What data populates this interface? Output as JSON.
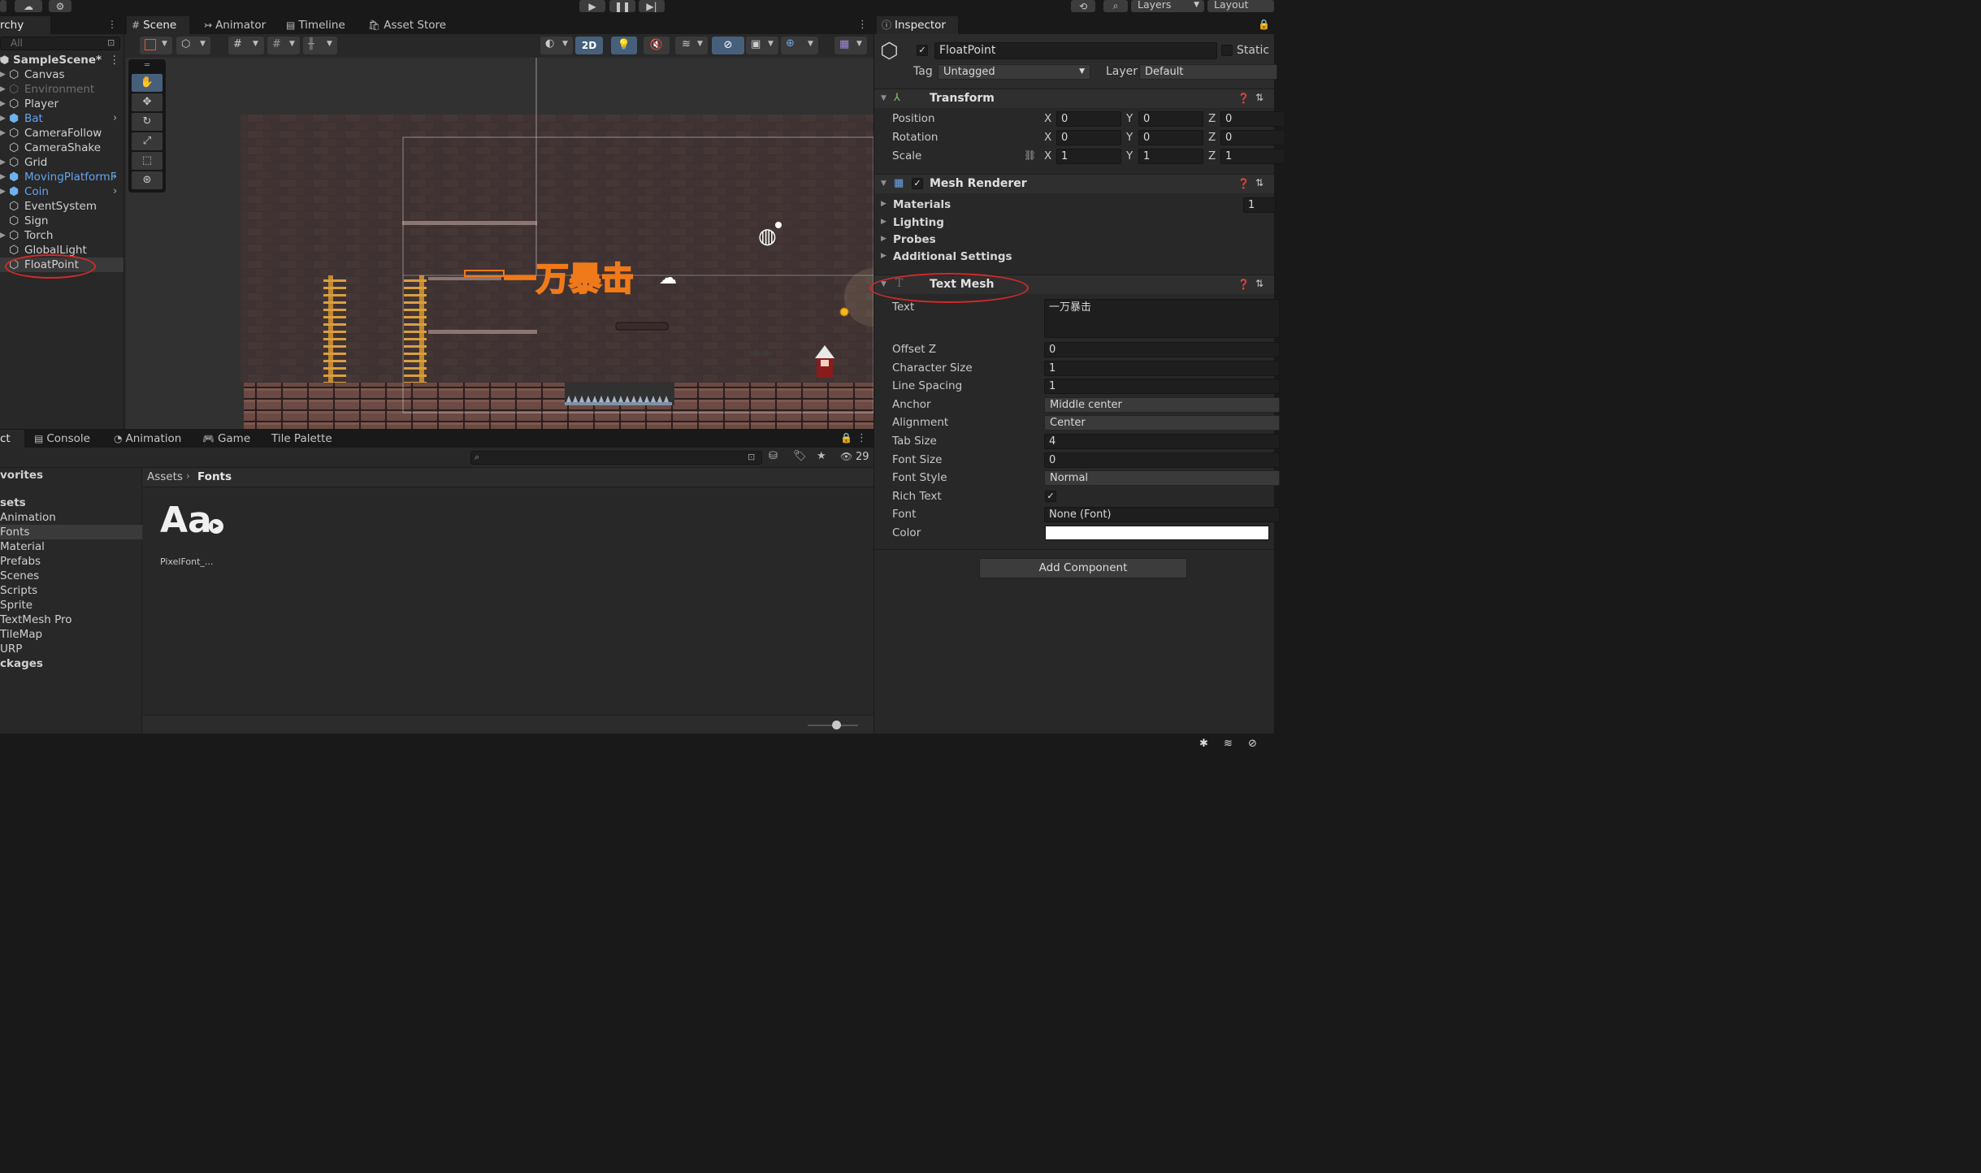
{
  "toolbar": {
    "play_icon": "play-icon",
    "pause_icon": "pause-icon",
    "step_icon": "step-icon",
    "layers_label": "Layers",
    "layout_label": "Layout"
  },
  "hierarchy": {
    "tab_label": "rchy",
    "search_placeholder": "All",
    "scene_name": "SampleScene*",
    "items": [
      {
        "label": "Canvas",
        "style": "normal",
        "expandable": true
      },
      {
        "label": "Environment",
        "style": "dim",
        "expandable": true
      },
      {
        "label": "Player",
        "style": "normal",
        "expandable": true
      },
      {
        "label": "Bat",
        "style": "prefab",
        "expandable": true,
        "child_arrow": true
      },
      {
        "label": "CameraFollow",
        "style": "normal",
        "expandable": true
      },
      {
        "label": "CameraShake",
        "style": "normal",
        "expandable": false
      },
      {
        "label": "Grid",
        "style": "normal",
        "expandable": true
      },
      {
        "label": "MovingPlatformF",
        "style": "prefab",
        "expandable": true,
        "child_arrow": true
      },
      {
        "label": "Coin",
        "style": "prefab",
        "expandable": true,
        "child_arrow": true
      },
      {
        "label": "EventSystem",
        "style": "normal",
        "expandable": false
      },
      {
        "label": "Sign",
        "style": "normal",
        "expandable": false
      },
      {
        "label": "Torch",
        "style": "normal",
        "expandable": true
      },
      {
        "label": "GlobalLight",
        "style": "normal",
        "expandable": false
      },
      {
        "label": "FloatPoint",
        "style": "selected",
        "expandable": false
      }
    ]
  },
  "scene": {
    "tabs": [
      {
        "label": "Scene",
        "icon": "grid-icon",
        "active": true
      },
      {
        "label": "Animator",
        "icon": "animator-icon",
        "active": false
      },
      {
        "label": "Timeline",
        "icon": "timeline-icon",
        "active": false
      },
      {
        "label": "Asset Store",
        "icon": "bag-icon",
        "active": false
      }
    ],
    "mode_2d_label": "2D",
    "floating_text": "一万暴击",
    "tools": [
      "hand-tool-icon",
      "move-tool-icon",
      "rotate-tool-icon",
      "scale-tool-icon",
      "rect-tool-icon",
      "transform-tool-icon"
    ]
  },
  "bottom": {
    "tabs": [
      {
        "label": "ct",
        "icon": ""
      },
      {
        "label": "Console",
        "icon": "console-icon"
      },
      {
        "label": "Animation",
        "icon": "animation-icon"
      },
      {
        "label": "Game",
        "icon": "gamepad-icon"
      },
      {
        "label": "Tile Palette",
        "icon": ""
      }
    ],
    "hidden_count": "29",
    "breadcrumb": [
      "Assets",
      "Fonts"
    ],
    "tree": [
      {
        "label": "vorites",
        "bold": true
      },
      {
        "label": "sets",
        "bold": true
      },
      {
        "label": "Animation",
        "bold": false
      },
      {
        "label": "Fonts",
        "bold": false,
        "selected": true
      },
      {
        "label": "Material",
        "bold": false
      },
      {
        "label": "Prefabs",
        "bold": false
      },
      {
        "label": "Scenes",
        "bold": false
      },
      {
        "label": "Scripts",
        "bold": false
      },
      {
        "label": "Sprite",
        "bold": false
      },
      {
        "label": "TextMesh Pro",
        "bold": false
      },
      {
        "label": "TileMap",
        "bold": false
      },
      {
        "label": "URP",
        "bold": false
      },
      {
        "label": "ckages",
        "bold": true
      }
    ],
    "asset": {
      "preview": "Aa",
      "name": "PixelFont_..."
    }
  },
  "inspector": {
    "tab_label": "Inspector",
    "object_name": "FloatPoint",
    "static_label": "Static",
    "tag_label": "Tag",
    "tag_value": "Untagged",
    "layer_label": "Layer",
    "layer_value": "Default",
    "transform": {
      "title": "Transform",
      "rows": [
        {
          "label": "Position",
          "x": "0",
          "y": "0",
          "z": "0"
        },
        {
          "label": "Rotation",
          "x": "0",
          "y": "0",
          "z": "0"
        },
        {
          "label": "Scale",
          "x": "1",
          "y": "1",
          "z": "1"
        }
      ],
      "axis": [
        "X",
        "Y",
        "Z"
      ]
    },
    "mesh_renderer": {
      "title": "Mesh Renderer",
      "sections": [
        "Materials",
        "Lighting",
        "Probes",
        "Additional Settings"
      ],
      "materials_count": "1"
    },
    "text_mesh": {
      "title": "Text Mesh",
      "text_label": "Text",
      "text_value": "一万暴击",
      "rows": [
        {
          "label": "Offset Z",
          "value": "0",
          "kind": "field"
        },
        {
          "label": "Character Size",
          "value": "1",
          "kind": "field"
        },
        {
          "label": "Line Spacing",
          "value": "1",
          "kind": "field"
        },
        {
          "label": "Anchor",
          "value": "Middle center",
          "kind": "dropdown"
        },
        {
          "label": "Alignment",
          "value": "Center",
          "kind": "dropdown"
        },
        {
          "label": "Tab Size",
          "value": "4",
          "kind": "field"
        },
        {
          "label": "Font Size",
          "value": "0",
          "kind": "field"
        },
        {
          "label": "Font Style",
          "value": "Normal",
          "kind": "dropdown"
        },
        {
          "label": "Rich Text",
          "value": "✓",
          "kind": "checkbox"
        },
        {
          "label": "Font",
          "value": "None (Font)",
          "kind": "object"
        },
        {
          "label": "Color",
          "value": "",
          "kind": "color"
        }
      ],
      "color_value": "#ffffff"
    },
    "add_component_label": "Add Component"
  },
  "colors": {
    "prefab_blue": "#66a3f0",
    "annotation_red": "#d12a2a",
    "selection_orange": "#f07a1a"
  }
}
